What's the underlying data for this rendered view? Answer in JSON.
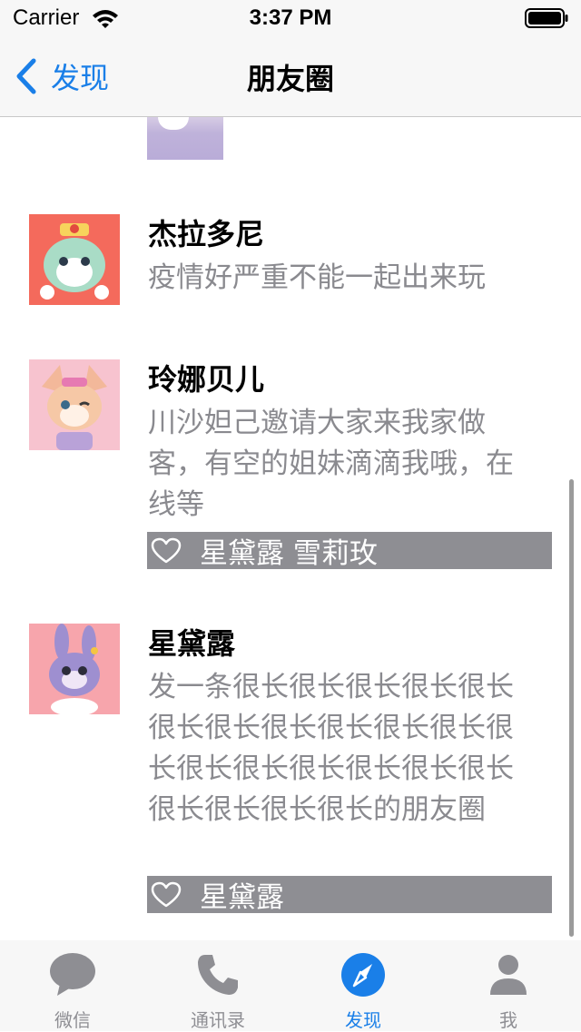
{
  "status_bar": {
    "carrier": "Carrier",
    "time": "3:37 PM"
  },
  "nav": {
    "back_label": "发现",
    "title": "朋友圈"
  },
  "posts": [
    {
      "name": "杰拉多尼",
      "text": "疫情好严重不能一起出来玩"
    },
    {
      "name": "玲娜贝儿",
      "text": "川沙妲己邀请大家来我家做客，有空的姐妹滴滴我哦，在线等",
      "likes": "星黛露  雪莉玫"
    },
    {
      "name": "星黛露",
      "text": "发一条很长很长很长很长很长很长很长很长很长很长很长很长很长很长很长很长很长很长很长很长很长很长的朋友圈",
      "likes": "星黛露"
    }
  ],
  "tabs": [
    {
      "label": "微信",
      "icon": "chat-bubble-icon"
    },
    {
      "label": "通讯录",
      "icon": "phone-icon"
    },
    {
      "label": "发现",
      "icon": "compass-icon"
    },
    {
      "label": "我",
      "icon": "person-icon"
    }
  ],
  "colors": {
    "accent": "#1a7fe8",
    "likes_bg": "#8e8e93",
    "secondary_text": "#8a8a8f",
    "tab_inactive": "#8e8e93",
    "bar_bg": "#f7f7f7"
  }
}
